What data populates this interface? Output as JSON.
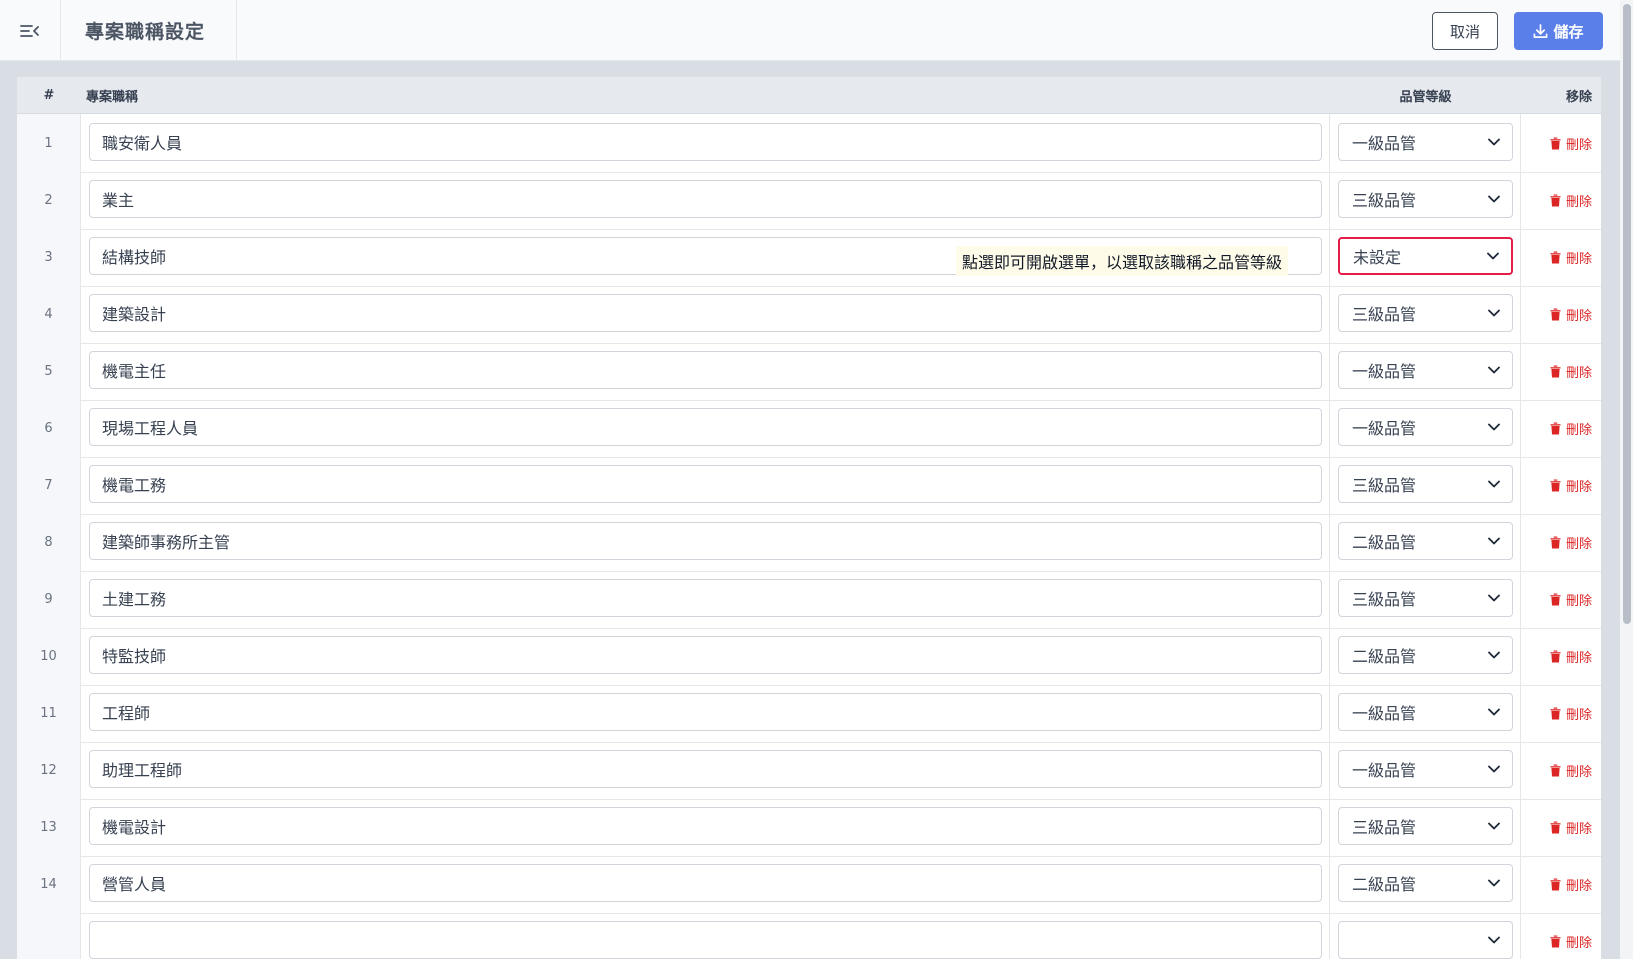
{
  "header": {
    "title": "專案職稱設定",
    "cancel_label": "取消",
    "save_label": "儲存",
    "accent_color": "#5b7fe9"
  },
  "table": {
    "columns": {
      "num": "#",
      "title": "專案職稱",
      "level": "品管等級",
      "remove": "移除"
    },
    "delete_label": "刪除",
    "rows": [
      {
        "num": "1",
        "title": "職安衛人員",
        "level": "一級品管"
      },
      {
        "num": "2",
        "title": "業主",
        "level": "三級品管"
      },
      {
        "num": "3",
        "title": "結構技師",
        "level": "未設定"
      },
      {
        "num": "4",
        "title": "建築設計",
        "level": "三級品管"
      },
      {
        "num": "5",
        "title": "機電主任",
        "level": "一級品管"
      },
      {
        "num": "6",
        "title": "現場工程人員",
        "level": "一級品管"
      },
      {
        "num": "7",
        "title": "機電工務",
        "level": "三級品管"
      },
      {
        "num": "8",
        "title": "建築師事務所主管",
        "level": "二級品管"
      },
      {
        "num": "9",
        "title": "土建工務",
        "level": "三級品管"
      },
      {
        "num": "10",
        "title": "特監技師",
        "level": "二級品管"
      },
      {
        "num": "11",
        "title": "工程師",
        "level": "一級品管"
      },
      {
        "num": "12",
        "title": "助理工程師",
        "level": "一級品管"
      },
      {
        "num": "13",
        "title": "機電設計",
        "level": "三級品管"
      },
      {
        "num": "14",
        "title": "營管人員",
        "level": "二級品管"
      },
      {
        "num": "",
        "title": "",
        "level": ""
      }
    ]
  },
  "tooltip": {
    "text": "點選即可開啟選單，以選取該職稱之品管等級"
  },
  "highlight_color": "#e11d48",
  "delete_color": "#dc2626"
}
